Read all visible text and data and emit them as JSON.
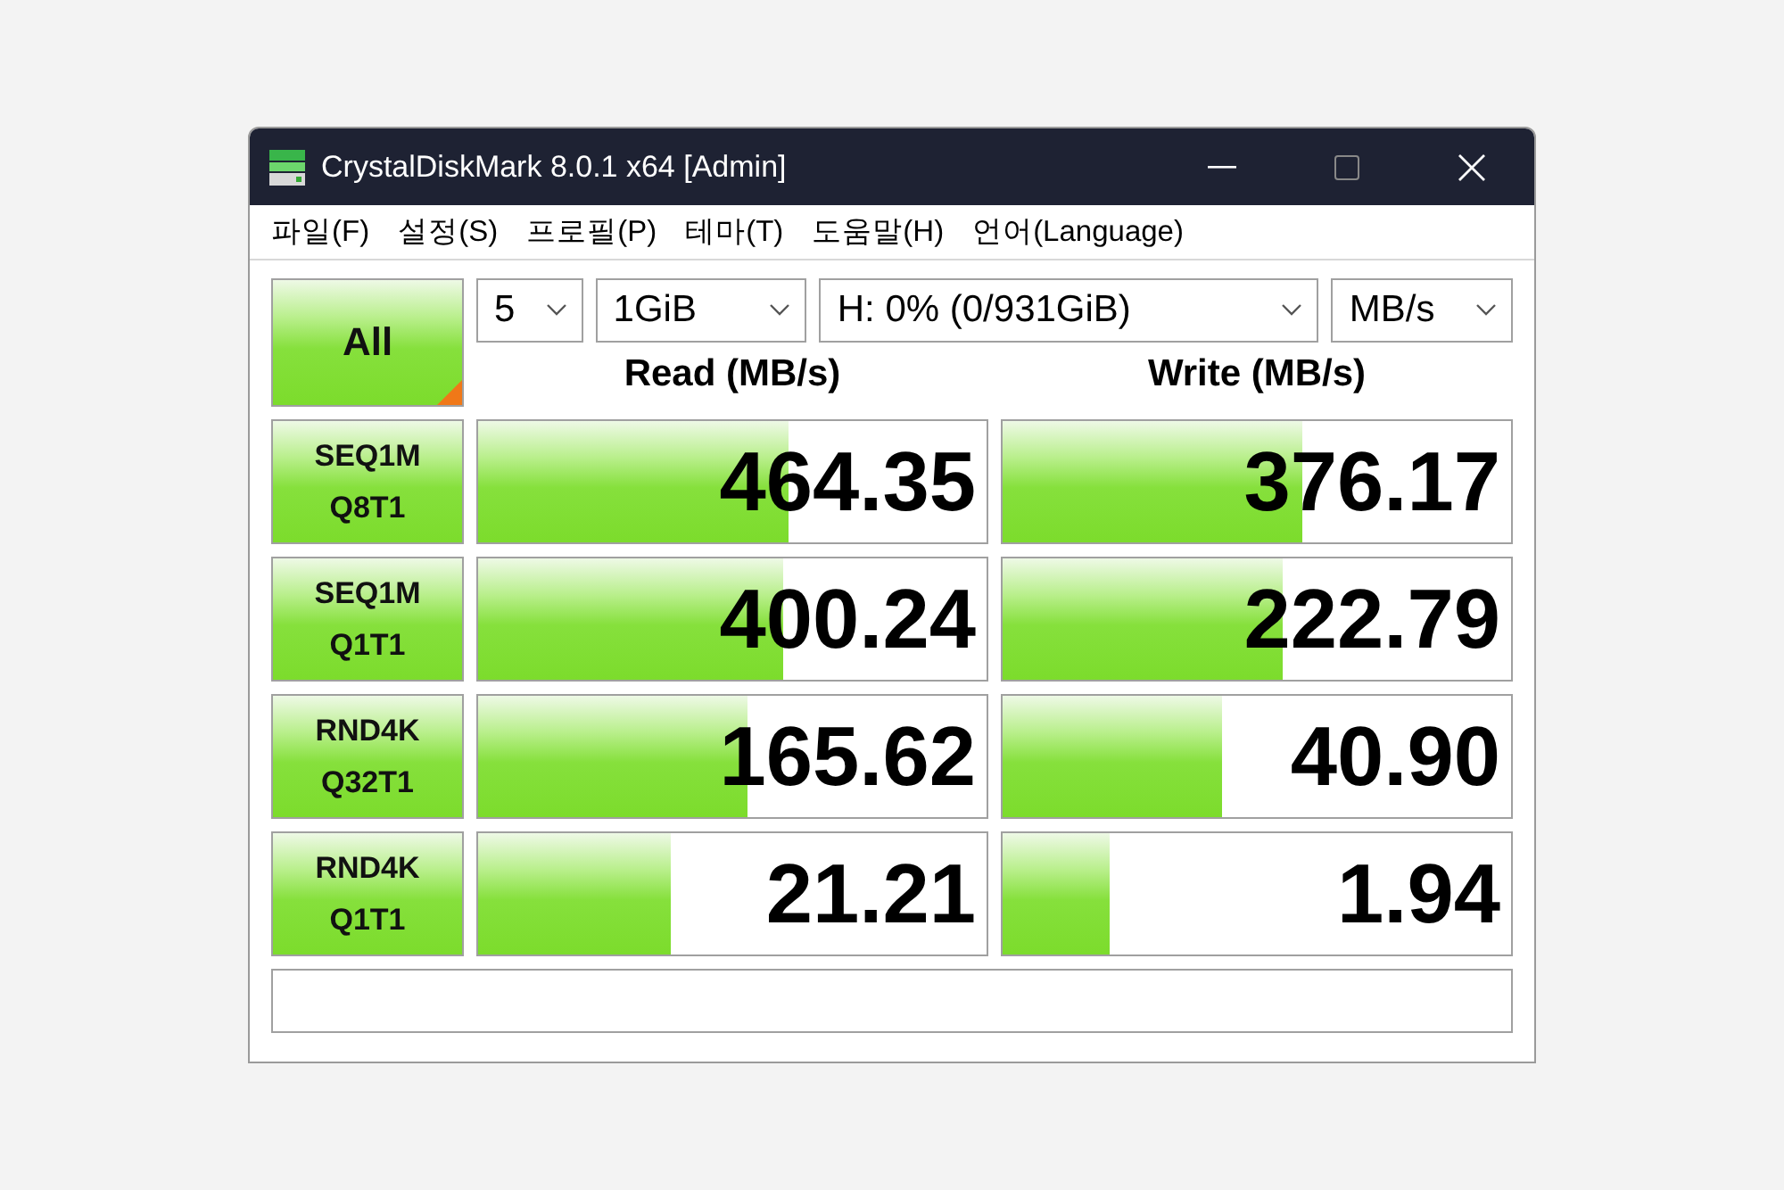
{
  "window": {
    "title": "CrystalDiskMark 8.0.1 x64 [Admin]"
  },
  "menu": [
    "파일(F)",
    "설정(S)",
    "프로필(P)",
    "테마(T)",
    "도움말(H)",
    "언어(Language)"
  ],
  "all_button": "All",
  "selectors": [
    {
      "value": "5"
    },
    {
      "value": "1GiB"
    },
    {
      "value": "H: 0% (0/931GiB)"
    },
    {
      "value": "MB/s"
    }
  ],
  "columns": [
    "Read (MB/s)",
    "Write (MB/s)"
  ],
  "tests": [
    {
      "name": "SEQ1M",
      "params": "Q8T1",
      "read": {
        "value": "464.35",
        "level": 0.61
      },
      "write": {
        "value": "376.17",
        "level": 0.59
      }
    },
    {
      "name": "SEQ1M",
      "params": "Q1T1",
      "read": {
        "value": "400.24",
        "level": 0.6
      },
      "write": {
        "value": "222.79",
        "level": 0.55
      }
    },
    {
      "name": "RND4K",
      "params": "Q32T1",
      "read": {
        "value": "165.62",
        "level": 0.53
      },
      "write": {
        "value": "40.90",
        "level": 0.43
      }
    },
    {
      "name": "RND4K",
      "params": "Q1T1",
      "read": {
        "value": "21.21",
        "level": 0.38
      },
      "write": {
        "value": "1.94",
        "level": 0.21
      }
    }
  ]
}
